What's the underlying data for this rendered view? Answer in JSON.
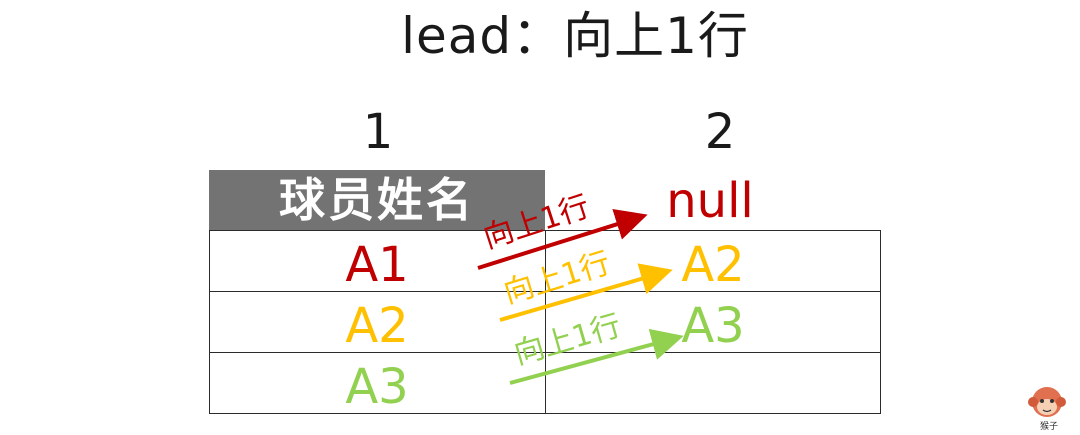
{
  "title": "lead：向上1行",
  "columns": {
    "left_number": "1",
    "right_number": "2"
  },
  "table": {
    "header": "球员姓名",
    "left_values": [
      "A1",
      "A2",
      "A3"
    ],
    "right_values": [
      "null",
      "A2",
      "A3"
    ]
  },
  "arrows": [
    {
      "label": "向上1行",
      "color": "#c00000"
    },
    {
      "label": "向上1行",
      "color": "#ffc000"
    },
    {
      "label": "向上1行",
      "color": "#92d050"
    }
  ],
  "colors": {
    "red": "#c00000",
    "yellow": "#ffc000",
    "green": "#92d050",
    "header_bg": "#737373"
  },
  "logo": {
    "icon": "monkey-face-icon",
    "text": "猴子"
  }
}
